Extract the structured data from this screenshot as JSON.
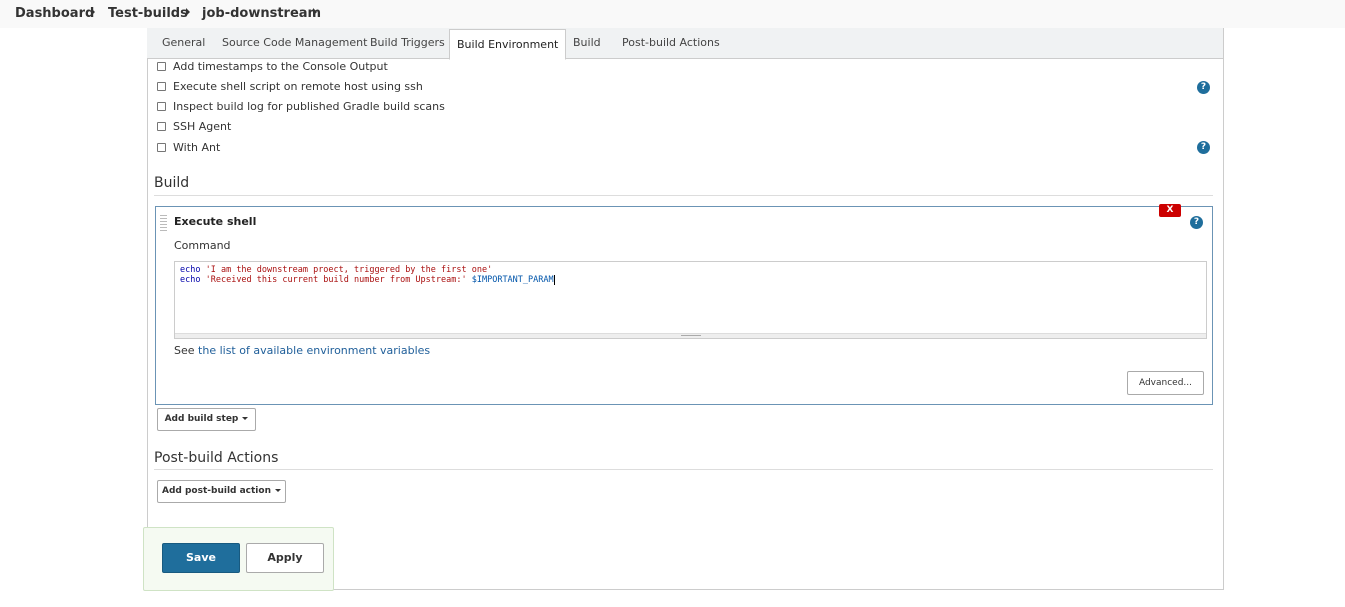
{
  "breadcrumb": {
    "items": [
      "Dashboard",
      "Test-builds",
      "job-downstream"
    ]
  },
  "tabs": [
    {
      "label": "General"
    },
    {
      "label": "Source Code Management"
    },
    {
      "label": "Build Triggers"
    },
    {
      "label": "Build Environment",
      "active": true
    },
    {
      "label": "Build"
    },
    {
      "label": "Post-build Actions"
    }
  ],
  "build_environment": {
    "options": [
      {
        "label": "Add timestamps to the Console Output",
        "checked": false
      },
      {
        "label": "Execute shell script on remote host using ssh",
        "checked": false
      },
      {
        "label": "Inspect build log for published Gradle build scans",
        "checked": false
      },
      {
        "label": "SSH Agent",
        "checked": false
      },
      {
        "label": "With Ant",
        "checked": false
      }
    ]
  },
  "build": {
    "title": "Build",
    "step": {
      "title": "Execute shell",
      "delete_label": "X",
      "command_label": "Command",
      "command_lines": [
        {
          "kw": "echo",
          "str": "'I am the downstream proect, triggered by the first one'",
          "var": ""
        },
        {
          "kw": "echo",
          "str": "'Received this current build number from Upstream:'",
          "var": "$IMPORTANT_PARAM"
        }
      ],
      "see_prefix": "See",
      "see_link": "the list of available environment variables",
      "advanced_label": "Advanced..."
    },
    "add_step_label": "Add build step"
  },
  "post_build": {
    "title": "Post-build Actions",
    "add_action_label": "Add post-build action"
  },
  "footer": {
    "save_label": "Save",
    "apply_label": "Apply"
  },
  "colors": {
    "primary": "#1f6e9c",
    "delete": "#cc0000",
    "link": "#205f9a"
  }
}
